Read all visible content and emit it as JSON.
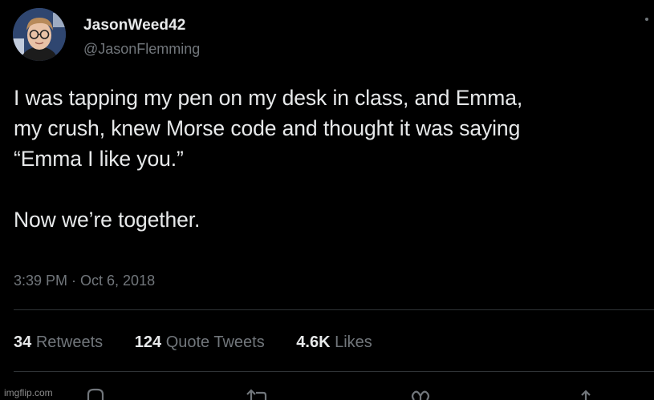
{
  "author": {
    "display_name": "JasonWeed42",
    "handle": "@JasonFlemming"
  },
  "tweet": {
    "text": "I was tapping my pen on my desk in class, and Emma,\nmy crush, knew Morse code and thought it was saying\n“Emma I like you.”\n\nNow we’re together.",
    "timestamp": "3:39 PM · Oct 6, 2018"
  },
  "stats": [
    {
      "count": "34",
      "label": "Retweets"
    },
    {
      "count": "124",
      "label": "Quote Tweets"
    },
    {
      "count": "4.6K",
      "label": "Likes"
    }
  ],
  "actions": [
    {
      "icon": "reply-icon"
    },
    {
      "icon": "retweet-icon"
    },
    {
      "icon": "like-icon"
    },
    {
      "icon": "share-icon"
    }
  ],
  "watermark": "imgflip.com",
  "colors": {
    "background": "#000000",
    "primary_text": "#e7e9ea",
    "secondary_text": "#71767b",
    "divider": "#2f3336"
  }
}
